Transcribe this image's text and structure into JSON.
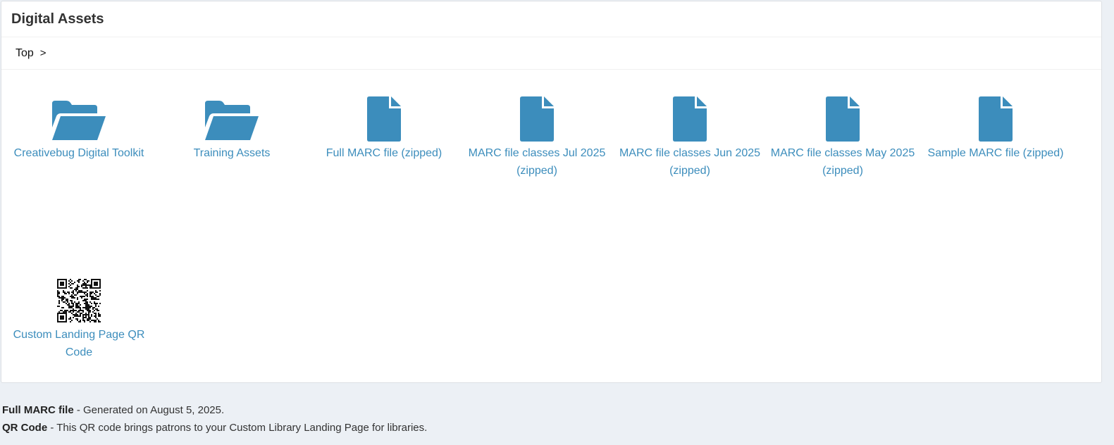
{
  "panel": {
    "title": "Digital Assets"
  },
  "breadcrumb": {
    "top": "Top",
    "separator": ">"
  },
  "colors": {
    "accent": "#3c8dbc"
  },
  "tiles": [
    {
      "label": "Creativebug Digital Toolkit",
      "icon": "folder-open-icon"
    },
    {
      "label": "Training Assets",
      "icon": "folder-open-icon"
    },
    {
      "label": "Full MARC file (zipped)",
      "icon": "file-icon"
    },
    {
      "label": "MARC file classes Jul 2025 (zipped)",
      "icon": "file-icon"
    },
    {
      "label": "MARC file classes Jun 2025 (zipped)",
      "icon": "file-icon"
    },
    {
      "label": "MARC file classes May 2025 (zipped)",
      "icon": "file-icon"
    },
    {
      "label": "Sample MARC file (zipped)",
      "icon": "file-icon"
    },
    {
      "label": "Custom Landing Page QR Code",
      "icon": "qr-code-icon"
    }
  ],
  "notes": {
    "marc_title": "Full MARC file",
    "marc_text": " - Generated on August 5, 2025.",
    "qr_title": "QR Code",
    "qr_text": " - This QR code brings patrons to your Custom Library Landing Page for libraries."
  }
}
